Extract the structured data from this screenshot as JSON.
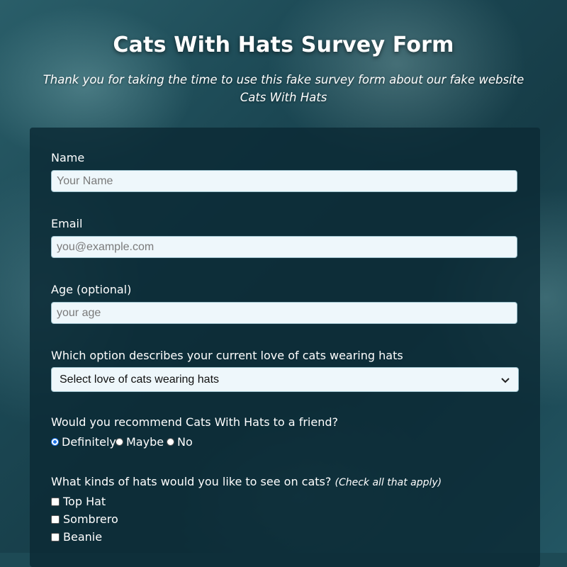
{
  "header": {
    "title": "Cats With Hats Survey Form",
    "description": "Thank you for taking the time to use this fake survey form about our fake website Cats With Hats"
  },
  "form": {
    "name": {
      "label": "Name",
      "placeholder": "Your Name",
      "value": ""
    },
    "email": {
      "label": "Email",
      "placeholder": "you@example.com",
      "value": ""
    },
    "age": {
      "label": "Age (optional)",
      "placeholder": "your age",
      "value": ""
    },
    "love_select": {
      "label": "Which option describes your current love of cats wearing hats",
      "selected": "Select love of cats wearing hats",
      "icon": "chevron-down-icon"
    },
    "recommend": {
      "label": "Would you recommend Cats With Hats to a friend?",
      "options": [
        {
          "label": "Definitely",
          "checked": true
        },
        {
          "label": "Maybe",
          "checked": false
        },
        {
          "label": "No",
          "checked": false
        }
      ]
    },
    "hats": {
      "label": "What kinds of hats would you like to see on cats?",
      "hint": "(Check all that apply)",
      "options": [
        {
          "label": "Top Hat",
          "checked": false
        },
        {
          "label": "Sombrero",
          "checked": false
        },
        {
          "label": "Beanie",
          "checked": false
        }
      ]
    }
  },
  "colors": {
    "background": "#1d4a55",
    "card": "#0b2a35",
    "input_bg": "#eef7fb",
    "radio_selected": "#1a73e8"
  }
}
